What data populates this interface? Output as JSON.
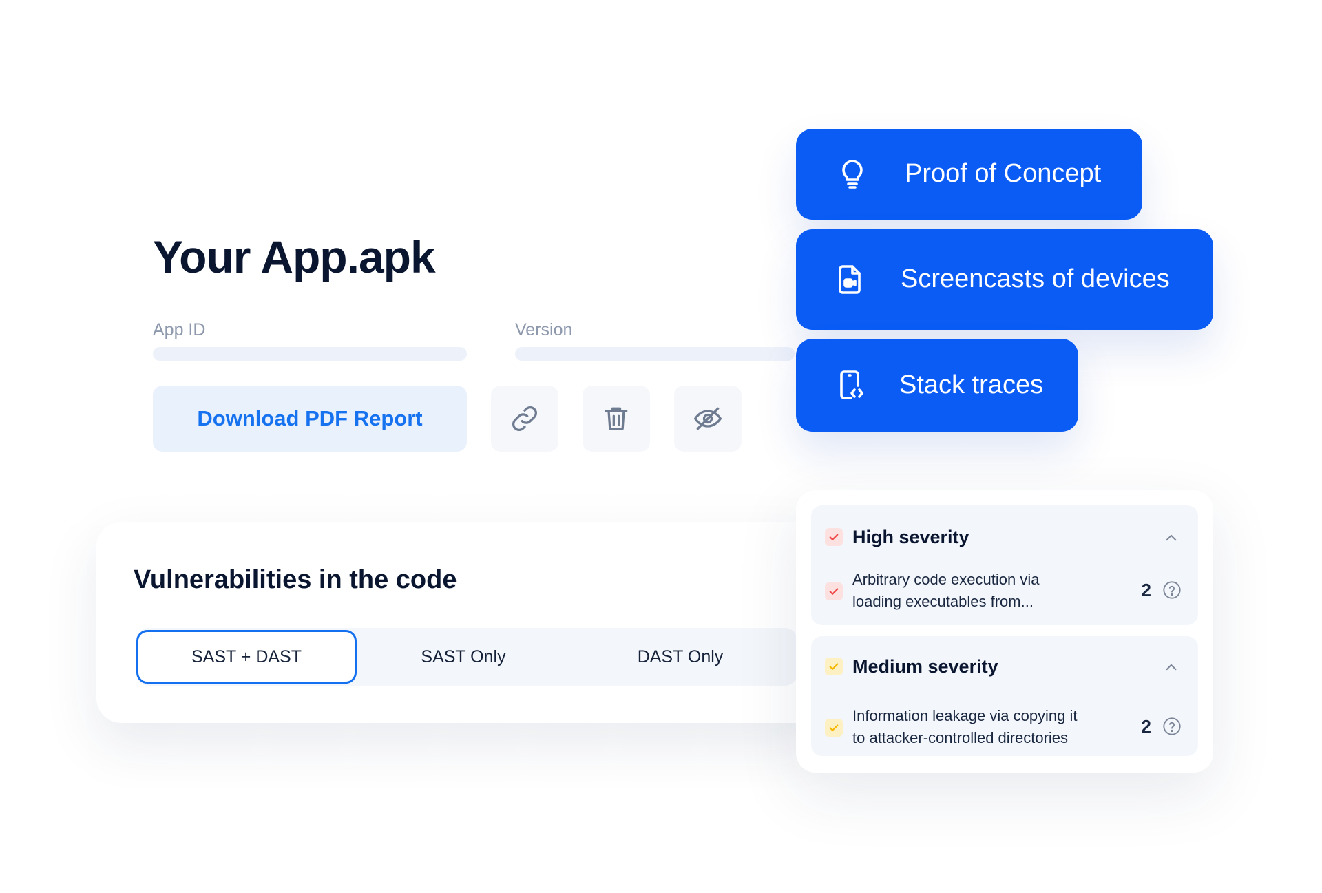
{
  "app": {
    "title": "Your App.apk",
    "app_id_label": "App ID",
    "version_label": "Version",
    "download_label": "Download PDF Report"
  },
  "icons": {
    "link": "link-icon",
    "trash": "trash-icon",
    "hide": "eye-off-icon"
  },
  "vulnerabilities": {
    "title": "Vulnerabilities in the code",
    "tabs": [
      {
        "label": "SAST + DAST",
        "selected": true
      },
      {
        "label": "SAST Only",
        "selected": false
      },
      {
        "label": "DAST Only",
        "selected": false
      }
    ]
  },
  "features": [
    {
      "label": "Proof of Concept",
      "icon": "lightbulb-icon"
    },
    {
      "label": "Screencasts of devices",
      "icon": "video-file-icon"
    },
    {
      "label": "Stack traces",
      "icon": "code-phone-icon"
    }
  ],
  "severity": {
    "groups": [
      {
        "title": "High severity",
        "color": "#f0494a",
        "items": [
          {
            "text_line1": "Arbitrary code execution via",
            "text_line2": "loading executables from...",
            "count": "2"
          }
        ]
      },
      {
        "title": "Medium severity",
        "color": "#f5b800",
        "items": [
          {
            "text_line1": "Information leakage via copying it",
            "text_line2": "to attacker-controlled directories",
            "count": "2"
          }
        ]
      }
    ]
  },
  "colors": {
    "brand_blue": "#0a5cf5",
    "accent_blue": "#1772f0",
    "title_dark": "#0a1630"
  }
}
